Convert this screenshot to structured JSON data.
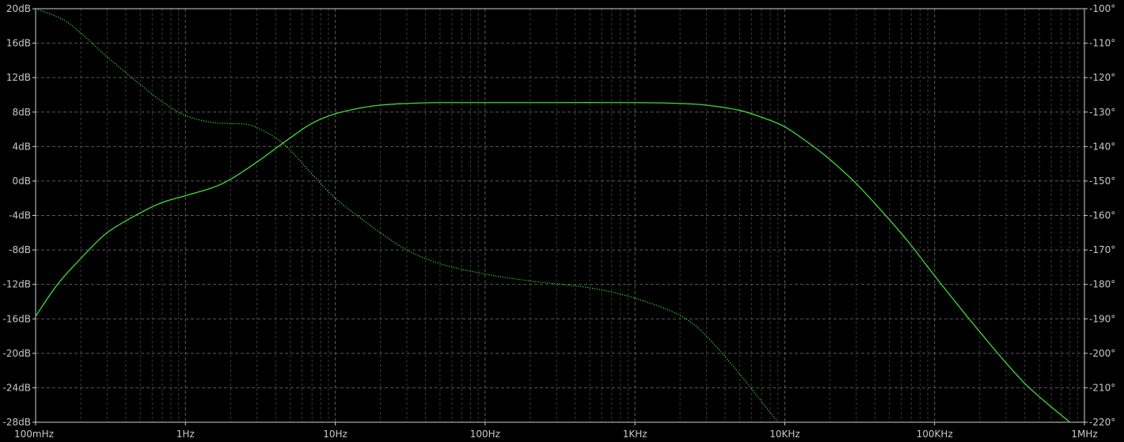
{
  "chart_data": {
    "type": "line",
    "x_scale": "log",
    "x_unit": "Hz",
    "xlim": [
      0.1,
      1000000
    ],
    "ylim_left": [
      -28,
      20
    ],
    "ylim_right": [
      -220,
      -100
    ],
    "x_ticks": [
      {
        "value": 0.1,
        "label": "100mHz"
      },
      {
        "value": 1,
        "label": "1Hz"
      },
      {
        "value": 10,
        "label": "10Hz"
      },
      {
        "value": 100,
        "label": "100Hz"
      },
      {
        "value": 1000,
        "label": "1KHz"
      },
      {
        "value": 10000,
        "label": "10KHz"
      },
      {
        "value": 100000,
        "label": "100KHz"
      },
      {
        "value": 1000000,
        "label": "1MHz"
      }
    ],
    "y_ticks_left": [
      {
        "value": 20,
        "label": "20dB"
      },
      {
        "value": 16,
        "label": "16dB"
      },
      {
        "value": 12,
        "label": "12dB"
      },
      {
        "value": 8,
        "label": "8dB"
      },
      {
        "value": 4,
        "label": "4dB"
      },
      {
        "value": 0,
        "label": "0dB"
      },
      {
        "value": -4,
        "label": "-4dB"
      },
      {
        "value": -8,
        "label": "-8dB"
      },
      {
        "value": -12,
        "label": "-12dB"
      },
      {
        "value": -16,
        "label": "-16dB"
      },
      {
        "value": -20,
        "label": "-20dB"
      },
      {
        "value": -24,
        "label": "-24dB"
      },
      {
        "value": -28,
        "label": "-28dB"
      }
    ],
    "y_ticks_right": [
      {
        "value": -100,
        "label": "-100°"
      },
      {
        "value": -110,
        "label": "-110°"
      },
      {
        "value": -120,
        "label": "-120°"
      },
      {
        "value": -130,
        "label": "-130°"
      },
      {
        "value": -140,
        "label": "-140°"
      },
      {
        "value": -150,
        "label": "-150°"
      },
      {
        "value": -160,
        "label": "-160°"
      },
      {
        "value": -170,
        "label": "-170°"
      },
      {
        "value": -180,
        "label": "-180°"
      },
      {
        "value": -190,
        "label": "-190°"
      },
      {
        "value": -200,
        "label": "-200°"
      },
      {
        "value": -210,
        "label": "-210°"
      },
      {
        "value": -220,
        "label": "-220°"
      }
    ],
    "grid": true,
    "colors": {
      "background": "#000000",
      "magnitude": "#3cdc3c",
      "phase": "#3cdc3c",
      "grid_major": "#5a5a5a",
      "grid_minor": "#3a3a3a",
      "text": "#c8c8c8"
    },
    "series": [
      {
        "id": "magnitude",
        "axis": "left",
        "style": "solid",
        "points": [
          [
            0.1,
            -15.7
          ],
          [
            0.14,
            -12
          ],
          [
            0.2,
            -9
          ],
          [
            0.3,
            -6
          ],
          [
            0.5,
            -3.7
          ],
          [
            0.7,
            -2.5
          ],
          [
            1.0,
            -1.7
          ],
          [
            1.5,
            -0.8
          ],
          [
            2.0,
            0.2
          ],
          [
            3.0,
            2.2
          ],
          [
            5.0,
            5.0
          ],
          [
            7.0,
            6.7
          ],
          [
            10,
            7.8
          ],
          [
            15,
            8.5
          ],
          [
            20,
            8.8
          ],
          [
            30,
            9.0
          ],
          [
            50,
            9.1
          ],
          [
            100,
            9.1
          ],
          [
            300,
            9.1
          ],
          [
            1000,
            9.1
          ],
          [
            2000,
            9.0
          ],
          [
            3000,
            8.8
          ],
          [
            5000,
            8.2
          ],
          [
            7000,
            7.4
          ],
          [
            10000,
            6.3
          ],
          [
            15000,
            4.2
          ],
          [
            20000,
            2.5
          ],
          [
            30000,
            -0.3
          ],
          [
            50000,
            -4.5
          ],
          [
            70000,
            -7.5
          ],
          [
            100000,
            -11
          ],
          [
            200000,
            -17.5
          ],
          [
            400000,
            -23.5
          ],
          [
            800000,
            -28
          ]
        ]
      },
      {
        "id": "phase",
        "axis": "right",
        "style": "dotted",
        "points": [
          [
            0.1,
            -100
          ],
          [
            0.15,
            -103
          ],
          [
            0.2,
            -107
          ],
          [
            0.3,
            -114
          ],
          [
            0.5,
            -122
          ],
          [
            0.7,
            -127
          ],
          [
            1.0,
            -131
          ],
          [
            1.5,
            -133
          ],
          [
            2.0,
            -133.3
          ],
          [
            2.5,
            -133.5
          ],
          [
            3.0,
            -134.5
          ],
          [
            4.0,
            -137.5
          ],
          [
            5.0,
            -141
          ],
          [
            7.0,
            -148
          ],
          [
            10,
            -155
          ],
          [
            15,
            -161
          ],
          [
            20,
            -165
          ],
          [
            30,
            -170
          ],
          [
            50,
            -174
          ],
          [
            100,
            -177
          ],
          [
            200,
            -179
          ],
          [
            500,
            -181
          ],
          [
            1000,
            -184
          ],
          [
            2000,
            -189
          ],
          [
            3000,
            -195
          ],
          [
            5000,
            -206
          ],
          [
            7000,
            -214
          ],
          [
            9000,
            -220
          ]
        ]
      }
    ]
  }
}
